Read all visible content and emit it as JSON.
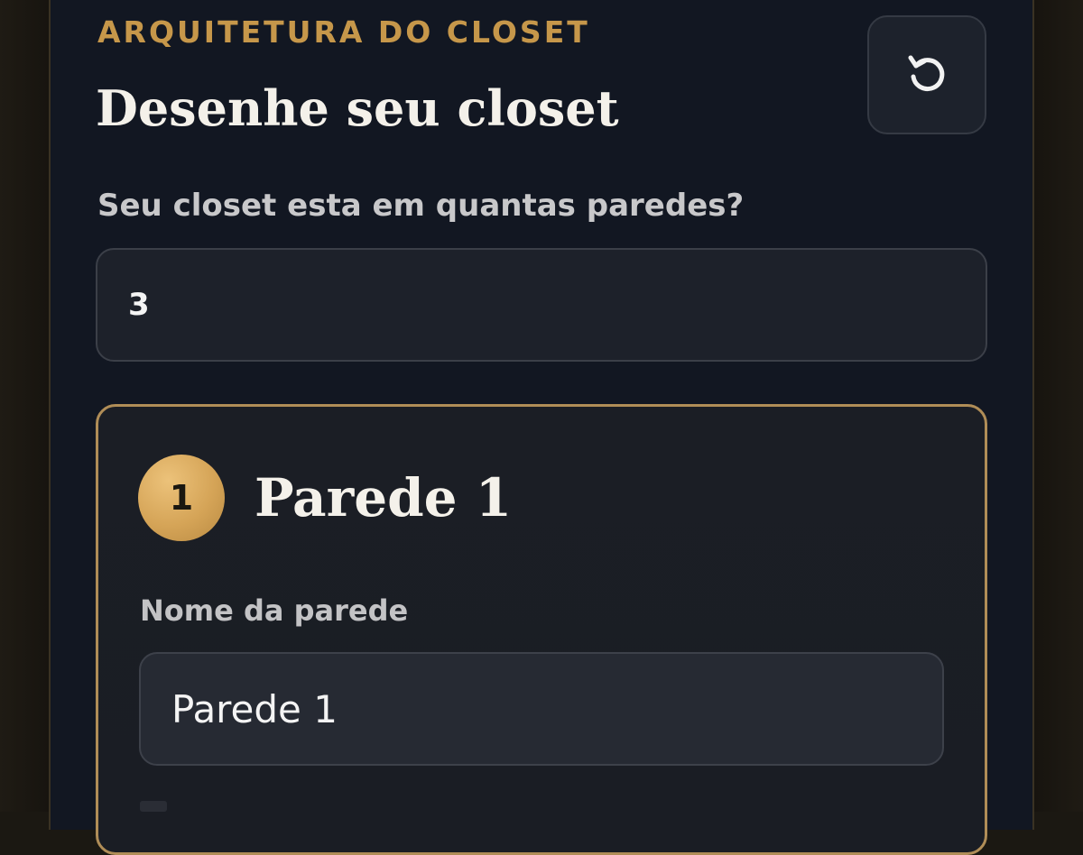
{
  "header": {
    "eyebrow": "ARQUITETURA DO CLOSET",
    "title": "Desenhe seu closet",
    "reset_icon": "reset-icon"
  },
  "walls_question": {
    "label": "Seu closet esta em quantas paredes?",
    "value": "3"
  },
  "wall_card": {
    "number": "1",
    "title": "Parede 1",
    "name_field": {
      "label": "Nome da parede",
      "value": "Parede 1"
    }
  },
  "colors": {
    "accent_gold": "#c6974a",
    "card_border": "#b08d57",
    "panel_bg": "#121722"
  }
}
